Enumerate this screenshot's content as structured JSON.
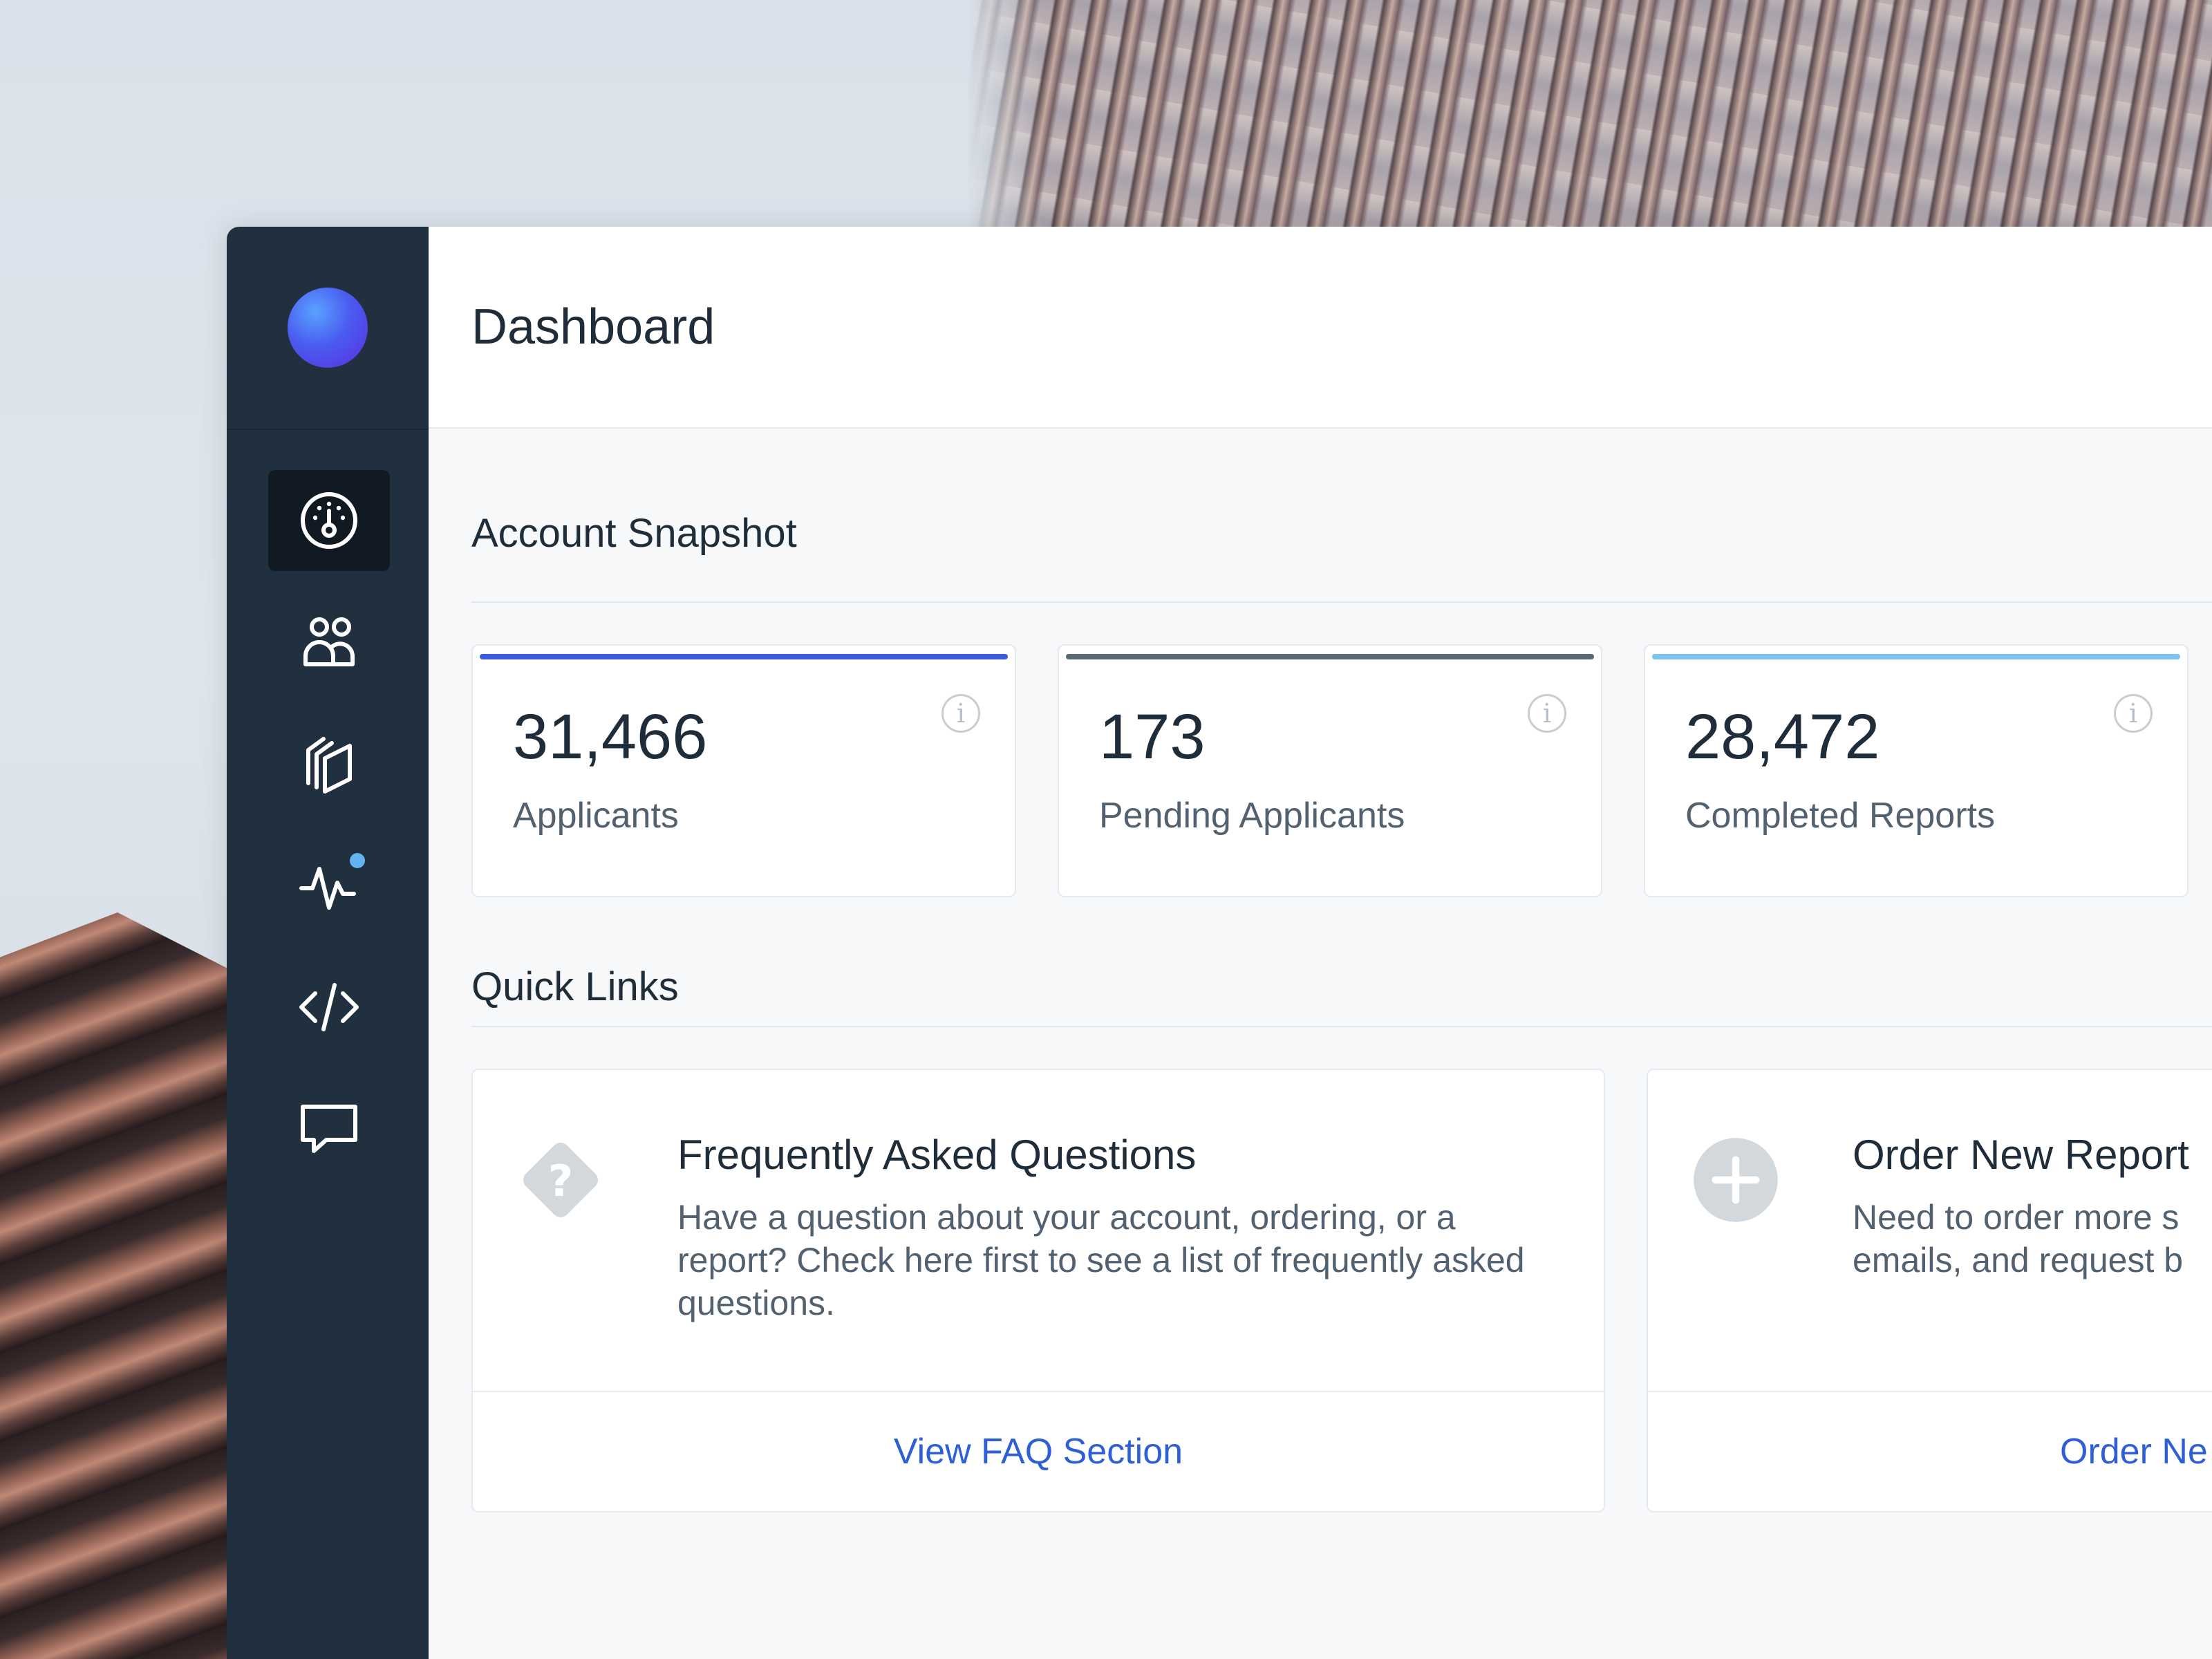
{
  "header": {
    "title": "Dashboard"
  },
  "sidebar": {
    "nav": [
      {
        "icon": "dashboard-gauge-icon",
        "active": true
      },
      {
        "icon": "users-icon",
        "active": false
      },
      {
        "icon": "documents-icon",
        "active": false
      },
      {
        "icon": "activity-icon",
        "active": false,
        "notification": true
      },
      {
        "icon": "code-icon",
        "active": false
      },
      {
        "icon": "chat-icon",
        "active": false
      }
    ],
    "notification_color": "#63b3ed"
  },
  "account_snapshot": {
    "title": "Account Snapshot",
    "cards": [
      {
        "value": "31,466",
        "label": "Applicants",
        "accent": "#3b5bdb"
      },
      {
        "value": "173",
        "label": "Pending Applicants",
        "accent": "#5a6872"
      },
      {
        "value": "28,472",
        "label": "Completed Reports",
        "accent": "#7cc4ee"
      }
    ]
  },
  "quick_links": {
    "title": "Quick Links",
    "cards": [
      {
        "icon": "question-diamond-icon",
        "title": "Frequently Asked Questions",
        "description": "Have a question about your account, ordering, or a report? Check here first to see a list of frequently asked questions.",
        "cta": "View FAQ Section"
      },
      {
        "icon": "plus-circle-icon",
        "title": "Order New Report",
        "description_line1": "Need to order more s",
        "description_line2": "emails, and request b",
        "cta": "Order Ne"
      }
    ]
  },
  "colors": {
    "link": "#2f5fd6",
    "sidebar": "#21303f"
  }
}
